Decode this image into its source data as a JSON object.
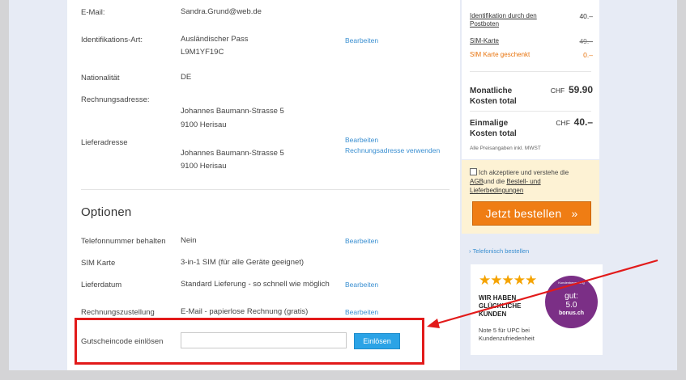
{
  "details": [
    {
      "label": "E-Mail:",
      "value": [
        "Sandra.Grund@web.de"
      ]
    },
    {
      "label": "Identifikations-Art:",
      "value": [
        "Ausländischer Pass",
        "L9M1YF19C"
      ],
      "edit": [
        "Bearbeiten"
      ]
    },
    {
      "label": "Nationalität",
      "value": [
        "DE"
      ]
    },
    {
      "label": "Rechnungsadresse:",
      "value": [
        "Johannes Baumann-Strasse 5",
        "9100 Herisau"
      ]
    },
    {
      "label": "Lieferadresse",
      "value": [
        "Johannes Baumann-Strasse 5",
        "9100 Herisau"
      ],
      "edit": [
        "Bearbeiten",
        "Rechnungsadresse verwenden"
      ]
    }
  ],
  "options": {
    "title": "Optionen",
    "rows": [
      {
        "label": "Telefonnummer behalten",
        "value": "Nein",
        "edit": "Bearbeiten"
      },
      {
        "label": "SIM Karte",
        "value": "3-in-1 SIM (für alle Geräte geeignet)",
        "edit": ""
      },
      {
        "label": "Lieferdatum",
        "value": "Standard Lieferung - so schnell wie möglich",
        "edit": "Bearbeiten"
      },
      {
        "label": "Rechnungszustellung",
        "value": "E-Mail - papierlose Rechnung (gratis)",
        "edit": "Bearbeiten"
      }
    ],
    "voucher": {
      "label": "Gutscheincode einlösen",
      "input_value": "",
      "button": "Einlösen"
    }
  },
  "summary": {
    "items": [
      {
        "label": "Identifikation durch den Postboten",
        "amount": "40.–"
      },
      {
        "label": "SIM-Karte",
        "amount": "49.–"
      },
      {
        "label": "SIM Karte geschenkt",
        "amount": "0.–"
      }
    ],
    "monthly": {
      "label": "Monatliche Kosten total",
      "currency": "CHF",
      "amount": "59.90"
    },
    "onetime": {
      "label": "Einmalige Kosten total",
      "currency": "CHF",
      "amount": "40.–"
    },
    "note": "Alle Preisangaben inkl. MWST"
  },
  "agb": {
    "text_before": "Ich akzeptiere und verstehe die",
    "agb_link": "AGB",
    "text_mid": "und die",
    "conditions_link": "Bestell- und Lieferbedingungen",
    "order_button": "Jetzt bestellen",
    "order_chevron": "»"
  },
  "phone_order": "Telefonisch bestellen",
  "badge": {
    "stars": "★★★★★",
    "headline": "WIR HABEN GLÜCKLICHE KUNDEN",
    "subtext": "Note 5 für UPC bei Kundenzufriedenheit",
    "circle_top": "Kundenbewertung",
    "grade_label": "gut:",
    "grade_value": "5.0",
    "brand": "bonus.ch"
  },
  "colors": {
    "accent_blue": "#2ba3e6",
    "order_orange": "#ef7d14",
    "annotation_red": "#e21a1a",
    "badge_purple": "#7b2f86"
  }
}
